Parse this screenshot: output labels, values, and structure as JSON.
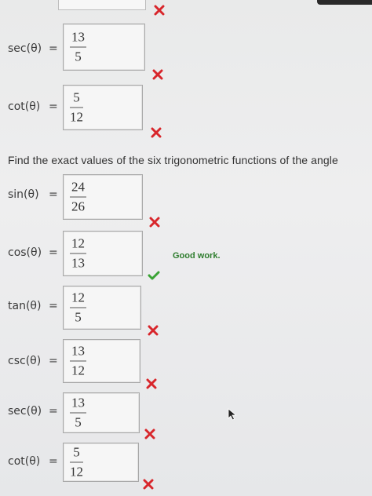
{
  "previous": {
    "rows": [
      {
        "label": "sec(θ)",
        "equals": "=",
        "numerator": "13",
        "denominator": "5",
        "result": "incorrect"
      },
      {
        "label": "cot(θ)",
        "equals": "=",
        "numerator": "5",
        "denominator": "12",
        "result": "incorrect"
      }
    ]
  },
  "question": {
    "text": "Find the exact values of the six trigonometric functions of the angle"
  },
  "current": {
    "rows": [
      {
        "label": "sin(θ)",
        "equals": "=",
        "numerator": "24",
        "denominator": "26",
        "result": "incorrect"
      },
      {
        "label": "cos(θ)",
        "equals": "=",
        "numerator": "12",
        "denominator": "13",
        "result": "correct"
      },
      {
        "label": "tan(θ)",
        "equals": "=",
        "numerator": "12",
        "denominator": "5",
        "result": "incorrect"
      },
      {
        "label": "csc(θ)",
        "equals": "=",
        "numerator": "13",
        "denominator": "12",
        "result": "incorrect"
      },
      {
        "label": "sec(θ)",
        "equals": "=",
        "numerator": "13",
        "denominator": "5",
        "result": "incorrect"
      },
      {
        "label": "cot(θ)",
        "equals": "=",
        "numerator": "5",
        "denominator": "12",
        "result": "incorrect"
      }
    ],
    "feedback": "Good work."
  },
  "colors": {
    "incorrect": "#d8262b",
    "correct": "#3aa335"
  },
  "icons": {
    "incorrect": "x-mark-icon",
    "correct": "check-mark-icon"
  }
}
